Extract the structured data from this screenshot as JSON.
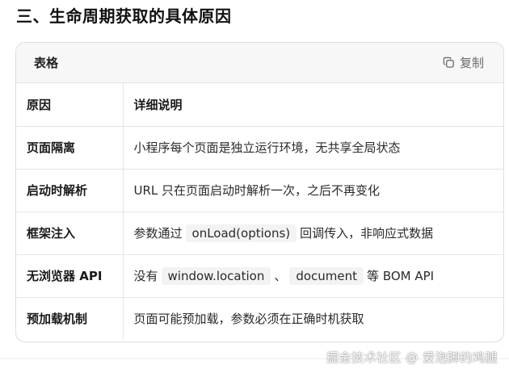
{
  "section_heading": "三、生命周期获取的具体原因",
  "card": {
    "title": "表格",
    "copy_label": "复制",
    "copy_icon": "copy-icon"
  },
  "table": {
    "headers": [
      "原因",
      "详细说明"
    ],
    "rows": [
      {
        "reason": "页面隔离",
        "text": "小程序每个页面是独立运行环境，无共享全局状态"
      },
      {
        "reason": "启动时解析",
        "text": "URL 只在页面启动时解析一次，之后不再变化"
      },
      {
        "reason": "框架注入",
        "pre": "参数通过",
        "code1": "onLoad(options)",
        "post": "回调传入，非响应式数据"
      },
      {
        "reason": "无浏览器 API",
        "pre": "没有",
        "code1": "window.location",
        "mid": "、",
        "code2": "document",
        "post": "等 BOM API"
      },
      {
        "reason": "预加载机制",
        "text": "页面可能预加载，参数必须在正确时机获取"
      }
    ]
  },
  "watermark": "掘金技术社区 @ 爱泡脚的鸡腿"
}
